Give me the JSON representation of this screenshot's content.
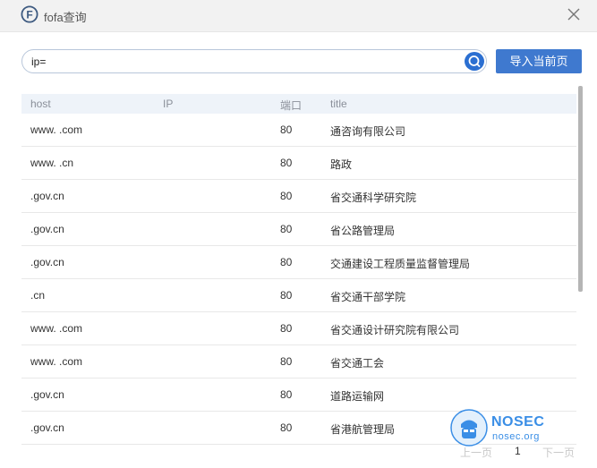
{
  "window": {
    "title": "fofa查询",
    "logo_letter": "F"
  },
  "search": {
    "value": "ip=",
    "import_label": "导入当前页"
  },
  "table": {
    "columns": [
      "host",
      "IP",
      "端口",
      "title"
    ],
    "rows": [
      {
        "host": "www.      .com",
        "ip": "",
        "port": "80",
        "title": "通咨询有限公司"
      },
      {
        "host": "www.      .cn",
        "ip": "",
        "port": "80",
        "title": "路政"
      },
      {
        "host": "          .gov.cn",
        "ip": "",
        "port": "80",
        "title": "省交通科学研究院"
      },
      {
        "host": "          .gov.cn",
        "ip": "",
        "port": "80",
        "title": "省公路管理局"
      },
      {
        "host": "          .gov.cn",
        "ip": "",
        "port": "80",
        "title": "交通建设工程质量监督管理局"
      },
      {
        "host": "          .cn",
        "ip": "",
        "port": "80",
        "title": "省交通干部学院"
      },
      {
        "host": "www.      .com",
        "ip": "",
        "port": "80",
        "title": "省交通设计研究院有限公司"
      },
      {
        "host": "www.      .com",
        "ip": "",
        "port": "80",
        "title": "省交通工会"
      },
      {
        "host": "          .gov.cn",
        "ip": "",
        "port": "80",
        "title": "道路运输网"
      },
      {
        "host": "          .gov.cn",
        "ip": "",
        "port": "80",
        "title": "省港航管理局"
      }
    ]
  },
  "pagination": {
    "prev": "上一页",
    "current": "1",
    "next": "下一页"
  },
  "watermark": {
    "brand": "NOSEC",
    "domain": "nosec.org"
  },
  "colors": {
    "accent": "#3f79cf",
    "title_bar": "#f2f2f2",
    "header_bg": "#eef3f9",
    "watermark": "#3a8ee6"
  }
}
